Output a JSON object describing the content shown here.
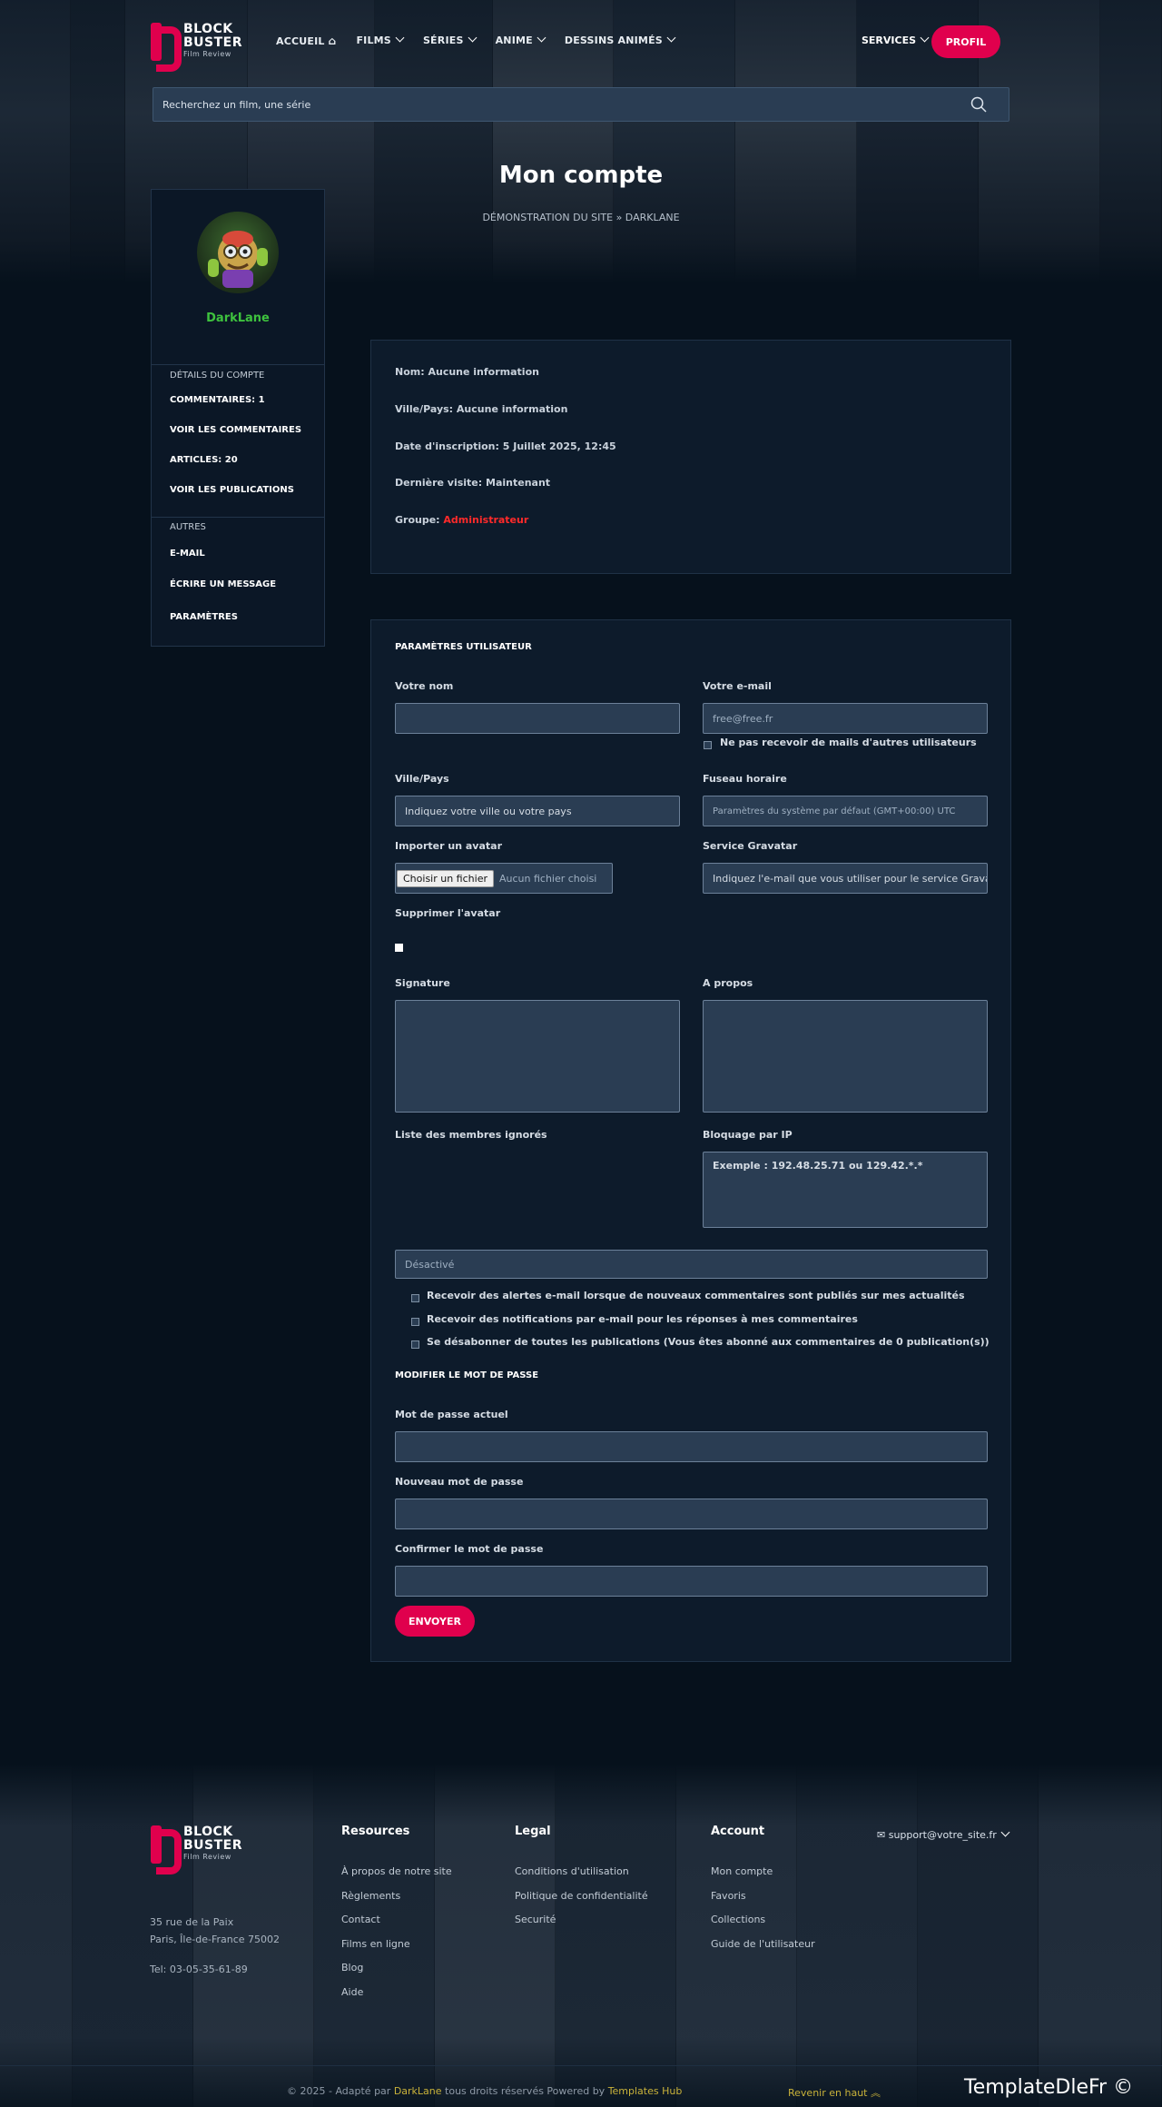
{
  "header": {
    "logo_line1": "BLOCK",
    "logo_line2": "BUSTER",
    "logo_tagline": "Film Review",
    "nav": [
      "ACCUEIL",
      "FILMS",
      "SÉRIES",
      "ANIME",
      "DESSINS ANIMÉS"
    ],
    "services": "SERVICES",
    "profil": "PROFIL",
    "search_placeholder": "Recherchez un film, une série"
  },
  "page": {
    "title": "Mon compte",
    "breadcrumb": "DÉMONSTRATION DU SITE » DARKLANE"
  },
  "sidebar": {
    "username": "DarkLane",
    "section1": "DÉTAILS DU COMPTE",
    "comments": "COMMENTAIRES: 1",
    "see_comments": "VOIR LES COMMENTAIRES",
    "articles": "ARTICLES: 20",
    "see_publications": "VOIR LES PUBLICATIONS",
    "section2": "AUTRES",
    "email": "E-MAIL",
    "write_message": "ÉCRIRE UN MESSAGE",
    "settings": "PARAMÈTRES"
  },
  "info": {
    "nom_label": "Nom:",
    "nom_value": "Aucune information",
    "ville_label": "Ville/Pays:",
    "ville_value": "Aucune information",
    "inscription_label": "Date d'inscription:",
    "inscription_value": "5 Juillet 2025, 12:45",
    "visite_label": "Dernière visite:",
    "visite_value": "Maintenant",
    "groupe_label": "Groupe:",
    "groupe_value": "Administrateur"
  },
  "settings": {
    "heading": "PARAMÈTRES UTILISATEUR",
    "nom_label": "Votre nom",
    "email_label": "Votre e-mail",
    "email_value": "free@free.fr",
    "no_mail": "Ne pas recevoir de mails d'autres utilisateurs",
    "ville_label": "Ville/Pays",
    "ville_placeholder": "Indiquez votre ville ou votre pays",
    "tz_label": "Fuseau horaire",
    "tz_value": "Paramètres du système par défaut (GMT+00:00) UTC",
    "avatar_label": "Importer un avatar",
    "file_button": "Choisir un fichier",
    "file_none": "Aucun fichier choisi",
    "gravatar_label": "Service Gravatar",
    "gravatar_placeholder": "Indiquez l'e-mail que vous utiliser pour le service Gravatar",
    "delete_avatar": "Supprimer l'avatar",
    "signature_label": "Signature",
    "apropos_label": "A propos",
    "ignored_label": "Liste des membres ignorés",
    "ip_label": "Bloquage par IP",
    "ip_example": "Exemple : 192.48.25.71 ou 129.42.*.*",
    "select_value": "Désactivé",
    "opt1": "Recevoir des alertes e-mail lorsque de nouveaux commentaires sont publiés sur mes actualités",
    "opt2": "Recevoir des notifications par e-mail pour les réponses à mes commentaires",
    "opt3": "Se désabonner de toutes les publications (Vous êtes abonné aux commentaires de 0 publication(s))",
    "pw_heading": "MODIFIER LE MOT DE PASSE",
    "pw_current": "Mot de passe actuel",
    "pw_new": "Nouveau mot de passe",
    "pw_confirm": "Confirmer le mot de passe",
    "submit": "ENVOYER"
  },
  "footer": {
    "address1": "35 rue de la Paix",
    "address2": "Paris, Île-de-France 75002",
    "tel": "Tel: 03-05-35-61-89",
    "col1_title": "Resources",
    "col1": [
      "À propos de notre site",
      "Règlements",
      "Contact",
      "Films en ligne",
      "Blog",
      "Aide"
    ],
    "col2_title": "Legal",
    "col2": [
      "Conditions d'utilisation",
      "Politique de confidentialité",
      "Securité"
    ],
    "col3_title": "Account",
    "col3": [
      "Mon compte",
      "Favoris",
      "Collections",
      "Guide de l'utilisateur"
    ],
    "support": "support@votre_site.fr",
    "copy_prefix": "© 2025 - Adapté par ",
    "copy_author": "DarkLane",
    "copy_mid": " tous droits réservés Powered by ",
    "copy_hub": "Templates Hub",
    "back_top": "Revenir en haut",
    "watermark": "TemplateDleFr ©"
  },
  "colors": {
    "accent": "#e0004d",
    "bg": "#06111c",
    "card": "#0d1b2b",
    "online": "#3ec23e",
    "admin": "#ff2a2a"
  }
}
